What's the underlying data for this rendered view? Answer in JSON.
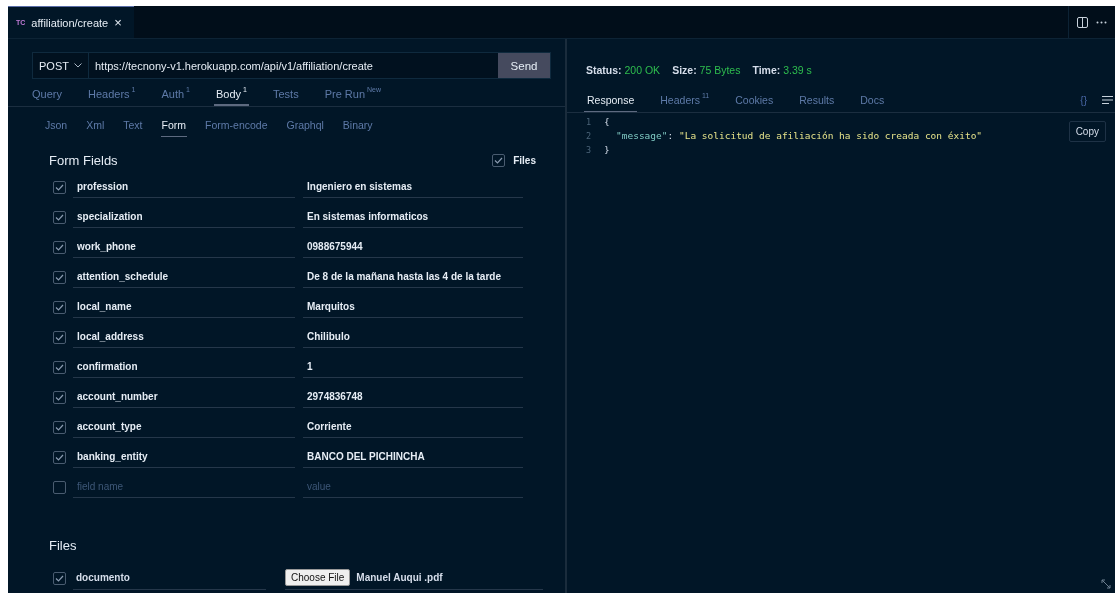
{
  "tab": {
    "badge": "TC",
    "title": "affiliation/create",
    "close": "×"
  },
  "request": {
    "method": "POST",
    "url": "https://tecnony-v1.herokuapp.com/api/v1/affiliation/create",
    "send": "Send"
  },
  "request_tabs": [
    {
      "label": "Query",
      "selected": false
    },
    {
      "label": "Headers",
      "count": "1",
      "selected": false
    },
    {
      "label": "Auth",
      "count": "1",
      "selected": false
    },
    {
      "label": "Body",
      "count": "1",
      "selected": true
    },
    {
      "label": "Tests",
      "selected": false
    },
    {
      "label": "Pre Run",
      "count": "New",
      "selected": false
    }
  ],
  "body_tabs": [
    {
      "label": "Json",
      "selected": false
    },
    {
      "label": "Xml",
      "selected": false
    },
    {
      "label": "Text",
      "selected": false
    },
    {
      "label": "Form",
      "selected": true
    },
    {
      "label": "Form-encode",
      "selected": false
    },
    {
      "label": "Graphql",
      "selected": false
    },
    {
      "label": "Binary",
      "selected": false
    }
  ],
  "form": {
    "title": "Form Fields",
    "files_toggle": {
      "label": "Files",
      "checked": true
    },
    "fields": [
      {
        "name": "profession",
        "value": "Ingeniero en sistemas",
        "checked": true
      },
      {
        "name": "specialization",
        "value": "En sistemas informaticos",
        "checked": true
      },
      {
        "name": "work_phone",
        "value": "0988675944",
        "checked": true
      },
      {
        "name": "attention_schedule",
        "value": "De 8 de la mañana hasta las 4 de la tarde",
        "checked": true
      },
      {
        "name": "local_name",
        "value": "Marquitos",
        "checked": true
      },
      {
        "name": "local_address",
        "value": "Chilibulo",
        "checked": true
      },
      {
        "name": "confirmation",
        "value": "1",
        "checked": true
      },
      {
        "name": "account_number",
        "value": "2974836748",
        "checked": true
      },
      {
        "name": "account_type",
        "value": "Corriente",
        "checked": true
      },
      {
        "name": "banking_entity",
        "value": "BANCO DEL PICHINCHA",
        "checked": true
      }
    ],
    "new_field": {
      "name_placeholder": "field name",
      "value_placeholder": "value",
      "checked": false
    }
  },
  "files": {
    "title": "Files",
    "items": [
      {
        "name": "documento",
        "checked": true,
        "button": "Choose File",
        "file": "Manuel Auqui .pdf"
      }
    ]
  },
  "response": {
    "status_label": "Status:",
    "status": "200 OK",
    "size_label": "Size:",
    "size": "75 Bytes",
    "time_label": "Time:",
    "time": "3.39 s",
    "tabs": [
      {
        "label": "Response",
        "selected": true
      },
      {
        "label": "Headers",
        "count": "11",
        "selected": false
      },
      {
        "label": "Cookies",
        "selected": false
      },
      {
        "label": "Results",
        "selected": false
      },
      {
        "label": "Docs",
        "selected": false
      }
    ],
    "format_label": "{}",
    "lines": [
      {
        "number": "1",
        "kind": "bracket",
        "tokens": [
          {
            "kind": "punct",
            "text": "{"
          }
        ]
      },
      {
        "number": "2",
        "kind": "member",
        "tokens": [
          {
            "kind": "key",
            "text": "\"message\""
          },
          {
            "kind": "punct",
            "text": ": "
          },
          {
            "kind": "string",
            "text": "\"La solicitud de afiliación ha sido creada con éxito\""
          }
        ]
      },
      {
        "number": "3",
        "kind": "bracket",
        "tokens": [
          {
            "kind": "punct",
            "text": "}"
          }
        ]
      }
    ],
    "copy": "Copy"
  }
}
